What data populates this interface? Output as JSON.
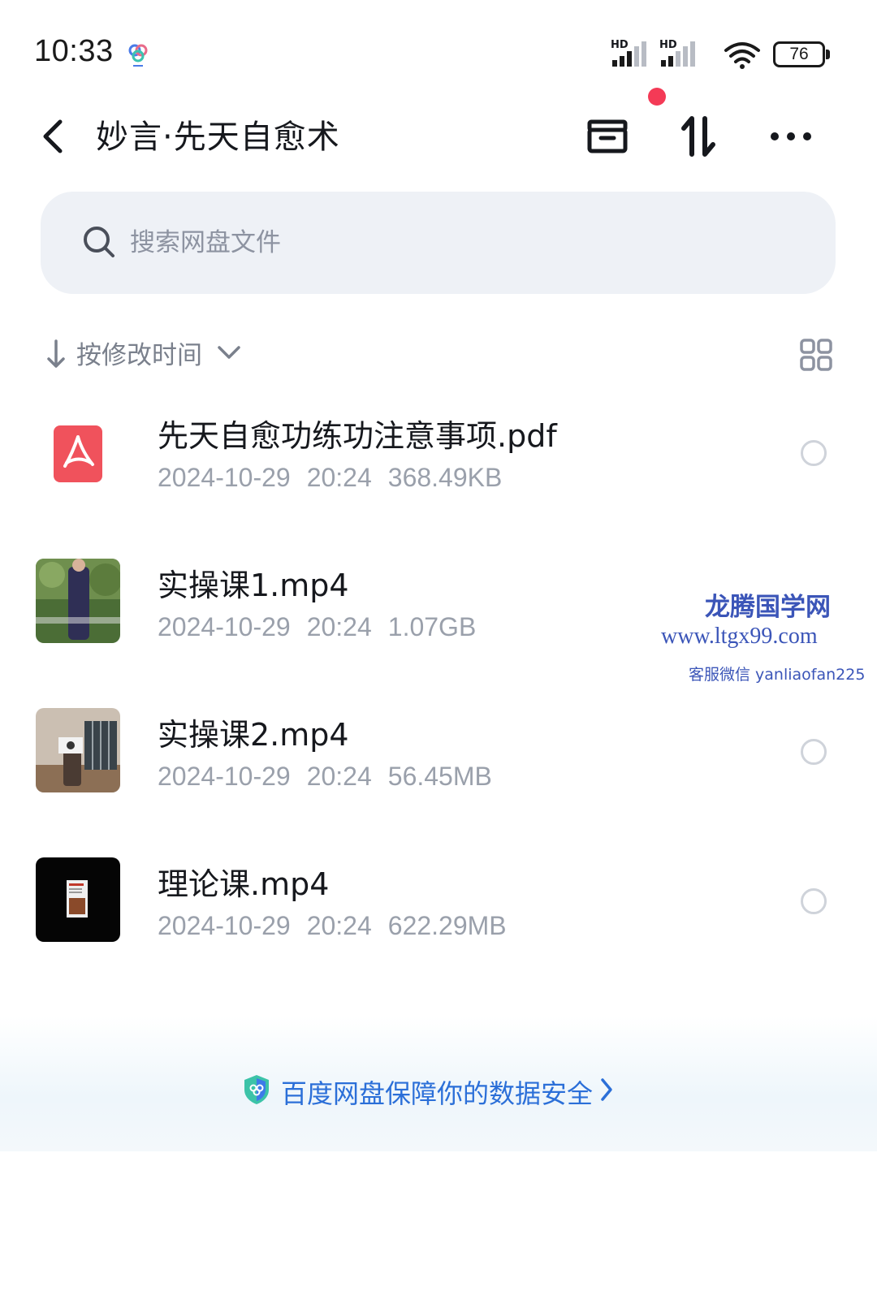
{
  "status_bar": {
    "time": "10:33",
    "signal_1_label": "HD",
    "signal_2_label": "HD",
    "battery_level": "76"
  },
  "header": {
    "title": "妙言·先天自愈术",
    "icons": [
      "back-icon",
      "archive-box-icon",
      "transfer-icon",
      "more-icon"
    ],
    "badge_color": "#f43a56"
  },
  "search": {
    "placeholder": "搜索网盘文件"
  },
  "sort": {
    "label": "按修改时间",
    "direction": "descending"
  },
  "files": [
    {
      "name": "先天自愈功练功注意事项.pdf",
      "date": "2024-10-29",
      "time": "20:24",
      "size": "368.49KB",
      "type": "pdf"
    },
    {
      "name": "实操课1.mp4",
      "date": "2024-10-29",
      "time": "20:24",
      "size": "1.07GB",
      "type": "video"
    },
    {
      "name": "实操课2.mp4",
      "date": "2024-10-29",
      "time": "20:24",
      "size": "56.45MB",
      "type": "video"
    },
    {
      "name": "理论课.mp4",
      "date": "2024-10-29",
      "time": "20:24",
      "size": "622.29MB",
      "type": "video"
    }
  ],
  "watermark": {
    "title": "龙腾国学网",
    "url": "www.ltgx99.com",
    "contact": "客服微信 yanliaofan225"
  },
  "footer": {
    "text": "百度网盘保障你的数据安全"
  },
  "colors": {
    "accent_blue": "#2b6fd8",
    "pdf_red": "#f0525c",
    "search_bg": "#eef1f6"
  }
}
